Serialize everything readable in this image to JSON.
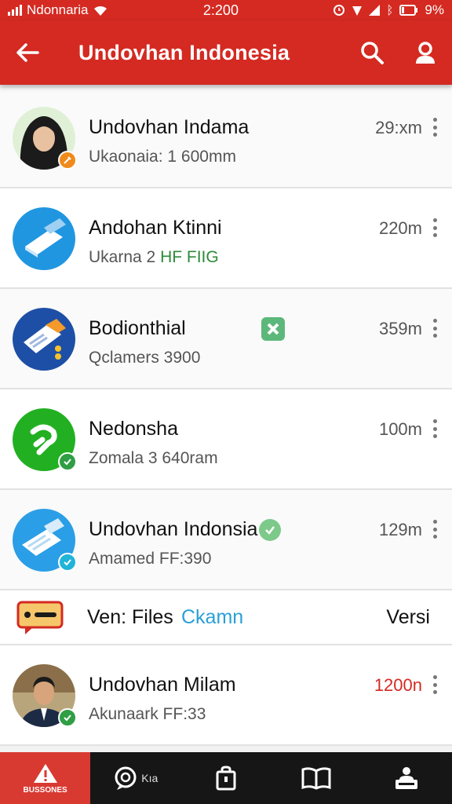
{
  "status_bar": {
    "carrier": "Ndonnaria",
    "time": "2:200",
    "battery": "9%"
  },
  "app_bar": {
    "title": "Undovhan  Indonesia",
    "icons": [
      "back-arrow-icon",
      "search-icon",
      "profile-icon"
    ]
  },
  "colors": {
    "primary": "#d42a22",
    "nav_background": "#161616",
    "link": "#2a9fd6",
    "time_highlight": "#d42a22"
  },
  "items": [
    {
      "title": "Undovhan Indama",
      "subtitle": "Ukaonaia: 1 600mm",
      "time": "29:xm"
    },
    {
      "title": "Andohan Ktinni",
      "subtitle_prefix": "Ukarna 2",
      "subtitle_highlight": "HF FIIG",
      "time": "220m"
    },
    {
      "title": "Bodionthial",
      "subtitle": "Qclamers 3900",
      "time": "359m"
    },
    {
      "title": "Nedonsha",
      "subtitle": "Zomala 3 640ram",
      "time": "100m"
    },
    {
      "title": "Undovhan Indonsia",
      "subtitle": "Amamed FF:390",
      "time": "129m"
    }
  ],
  "files_row": {
    "label": "Ven: Files",
    "link": "Ckamn",
    "right": "Versi"
  },
  "last_item": {
    "title": "Undovhan Milam",
    "subtitle": "Akunaark FF:33",
    "time": "1200n"
  },
  "bottom_nav": {
    "active_label": "BUSSONES",
    "second_label": "Kıa"
  }
}
